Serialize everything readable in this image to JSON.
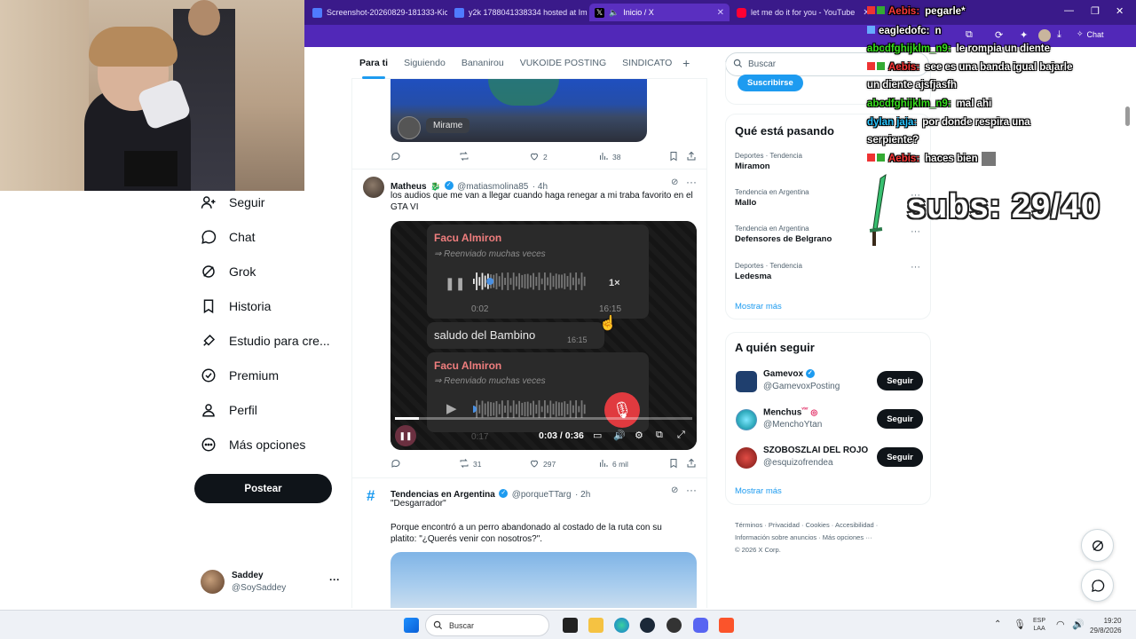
{
  "browser": {
    "tabs": [
      {
        "label": "Screenshot-20260829-181333-Kic",
        "icon": "image-icon",
        "color": "#4f7bff"
      },
      {
        "label": "y2k 1788041338334 hosted at Img",
        "icon": "image-icon",
        "color": "#4f7bff"
      },
      {
        "label": "Inicio / X",
        "icon": "x-logo-icon",
        "color": "#000000"
      },
      {
        "label": "let me do it for you - YouTube",
        "icon": "youtube-icon",
        "color": "#ff0033"
      }
    ],
    "toolbar_chat": "Chat"
  },
  "sidebar": {
    "items": [
      {
        "label": "Seguir",
        "icon": "add-person-icon"
      },
      {
        "label": "Chat",
        "icon": "chat-bubble-icon"
      },
      {
        "label": "Grok",
        "icon": "grok-icon"
      },
      {
        "label": "Historia",
        "icon": "bookmark-icon"
      },
      {
        "label": "Estudio para cre...",
        "icon": "rocket-icon"
      },
      {
        "label": "Premium",
        "icon": "verified-badge-icon"
      },
      {
        "label": "Perfil",
        "icon": "person-icon"
      },
      {
        "label": "Más opciones",
        "icon": "more-circle-icon"
      }
    ],
    "post_button": "Postear",
    "account": {
      "name": "Saddey",
      "handle": "@SoySaddey",
      "more": "···"
    }
  },
  "timeline": {
    "tabs": [
      "Para ti",
      "Siguiendo",
      "Bananirou",
      "VUKOIDE POSTING",
      "SINDICATO"
    ],
    "add_tab": "+",
    "post1": {
      "media_label": "Mirame",
      "replies": "",
      "reposts": "",
      "likes": "2",
      "views": "38"
    },
    "post2": {
      "name": "Matheus",
      "emoji": "🐉",
      "handle": "@matiasmolina85",
      "time": "· 4h",
      "text": "los audios que me van a llegar cuando haga renegar a mi traba favorito en el GTA VI",
      "video": {
        "contact1": "Facu Almiron",
        "forwarded1": "Reenviado muchas veces",
        "speed": "1×",
        "duration_start": "0:02",
        "time1": "16:15",
        "message": "saludo del Bambino",
        "time2": "16:15",
        "contact2": "Facu Almiron",
        "forwarded2": "Reenviado muchas veces",
        "faded_time": "0:17",
        "playback": "0:03 / 0:36",
        "progress": 0.08
      },
      "replies": "",
      "reposts": "31",
      "likes": "297",
      "views": "6 mil"
    },
    "post3": {
      "name": "Tendencias en Argentina",
      "handle": "@porqueTTarg",
      "time": "· 2h",
      "quote": "\"Desgarrador\"",
      "text": "Porque encontró a un perro abandonado al costado de la ruta con su platito: \"¿Querés venir con nosotros?\"."
    }
  },
  "right": {
    "search_placeholder": "Buscar",
    "subscribe": "Suscribirse",
    "trends_title": "Qué está pasando",
    "trends": [
      {
        "meta": "Deportes · Tendencia",
        "name": "Miramon"
      },
      {
        "meta": "Tendencia en Argentina",
        "name": "Mallo"
      },
      {
        "meta": "Tendencia en Argentina",
        "name": "Defensores de Belgrano"
      },
      {
        "meta": "Deportes · Tendencia",
        "name": "Ledesma"
      }
    ],
    "show_more": "Mostrar más",
    "follow_title": "A quién seguir",
    "follow": [
      {
        "name": "Gamevox",
        "handle": "@GamevoxPosting",
        "button": "Seguir",
        "color": "#1f3f6e"
      },
      {
        "name": "Menchus",
        "handle": "@MenchoYtan",
        "button": "Seguir",
        "color": "#2aa7b8"
      },
      {
        "name": "SZOBOSZLAI DEL ROJO",
        "handle": "@esquizofrendea",
        "button": "Seguir",
        "color": "#b5332e"
      }
    ],
    "show_more2": "Mostrar más",
    "footer1": "Términos · Privacidad · Cookies · Accesibilidad ·",
    "footer2": "Información sobre anuncios · Más opciones ···",
    "footer3": "© 2026 X Corp."
  },
  "stream": {
    "chat": [
      {
        "user": "Aebis:",
        "msg": "pegarle*",
        "color": "#ff3a3a"
      },
      {
        "user": "eagledofc:",
        "msg": "n",
        "color": "#ffffff"
      },
      {
        "user": "abcdfghijklm_n9:",
        "msg": "le rompia un diente",
        "color": "#38e01e"
      },
      {
        "user": "Aebis:",
        "msg": "see es una banda igual bajarle",
        "color": "#ff3a3a"
      },
      {
        "user": "",
        "msg": "un diente ajsfjasfh",
        "color": "#ff3a3a"
      },
      {
        "user": "abcdfghijklm_n9:",
        "msg": "mal ahi",
        "color": "#38e01e"
      },
      {
        "user": "dylan jaja:",
        "msg": "por donde respira una",
        "color": "#28c4ff"
      },
      {
        "user": "",
        "msg": "serpiente?",
        "color": "#28c4ff"
      },
      {
        "user": "Aebis:",
        "msg": "haces bien",
        "color": "#ff3a3a"
      }
    ],
    "subs": "subs: 29/40"
  },
  "taskbar": {
    "search": "Buscar",
    "lang1": "ESP",
    "lang2": "LAA",
    "time": "19:20",
    "date": "29/8/2026"
  }
}
